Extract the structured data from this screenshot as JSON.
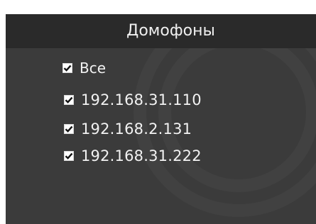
{
  "panel": {
    "title": "Домофоны",
    "colors": {
      "background": "#3b3b3b",
      "header_background": "#2a2a2a",
      "text": "#f2f2f2",
      "checkbox_fill": "#ffffff",
      "checkmark": "#111111"
    }
  },
  "select_all": {
    "label": "Все",
    "checked": true,
    "icon": "checkmark-icon"
  },
  "intercoms": [
    {
      "label": "192.168.31.110",
      "checked": true
    },
    {
      "label": "192.168.2.131",
      "checked": true
    },
    {
      "label": "192.168.31.222",
      "checked": true
    }
  ]
}
